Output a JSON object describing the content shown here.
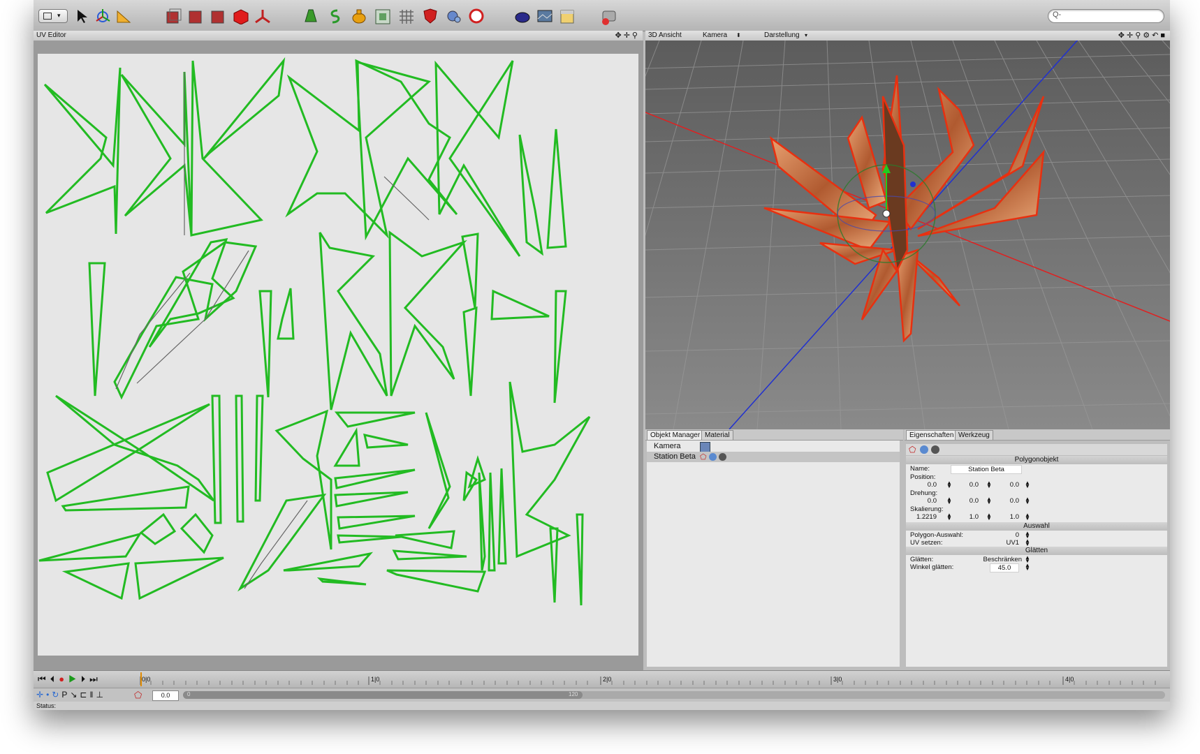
{
  "toolbar": {
    "icons": [
      "layout-icon",
      "pointer-icon",
      "move-icon",
      "ruler-icon",
      "cube-select-icon",
      "cube-move-icon",
      "cube-rotate-icon",
      "red-cube-icon",
      "axis-icon",
      "shape-icon",
      "spline-icon",
      "vase-icon",
      "box-icon",
      "grid-icon",
      "shield-icon",
      "camera-icon",
      "sphere-icon",
      "teapot-icon",
      "picture-icon",
      "scene-icon",
      "render-icon"
    ],
    "search_placeholder": "Q-"
  },
  "uv_editor": {
    "title": "UV Editor"
  },
  "view3d": {
    "title": "3D Ansicht",
    "menu_camera": "Kamera",
    "menu_display": "Darstellung"
  },
  "object_manager": {
    "tabs": [
      "Objekt Manager",
      "Material"
    ],
    "items": [
      {
        "label": "Kamera",
        "selected": false
      },
      {
        "label": "Station Beta",
        "selected": true
      }
    ]
  },
  "properties": {
    "tabs": [
      "Eigenschaften",
      "Werkzeug"
    ],
    "section_object": "Polygonobjekt",
    "name_label": "Name:",
    "name_value": "Station Beta",
    "position_label": "Position:",
    "position": [
      "0.0",
      "0.0",
      "0.0"
    ],
    "rotation_label": "Drehung:",
    "rotation": [
      "0.0",
      "0.0",
      "0.0"
    ],
    "scale_label": "Skalierung:",
    "scale": [
      "1.2219",
      "1.0",
      "1.0"
    ],
    "section_selection": "Auswahl",
    "poly_select_label": "Polygon-Auswahl:",
    "poly_select_value": "0",
    "uv_label": "UV setzen:",
    "uv_value": "UV1",
    "section_smooth": "Glätten",
    "smooth_label": "Glätten:",
    "smooth_value": "Beschränken",
    "angle_label": "Winkel glätten:",
    "angle_value": "45.0"
  },
  "timeline": {
    "ticks": [
      "0|0",
      "1|0",
      "2|0",
      "3|0",
      "4|0"
    ],
    "current_frame": "0.0",
    "range_start": "0",
    "range_end": "120"
  },
  "status": {
    "label": "Status:"
  },
  "colors": {
    "uv_stroke": "#22bb22",
    "x_axis": "#e02020",
    "z_axis": "#2030d0",
    "object_fill": "#c8643c"
  }
}
